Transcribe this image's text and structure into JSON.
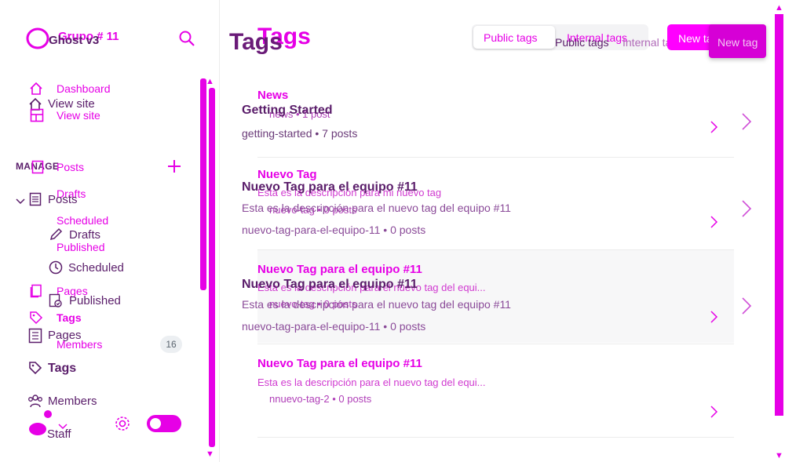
{
  "site": {
    "name_a": "Grupo # 11",
    "name_b": "Ghost v3"
  },
  "sidebar": {
    "dashboard": "Dashboard",
    "view_site_a": "View site",
    "view_site_b": "View site",
    "manage": "MANAGE",
    "posts_a": "Posts",
    "posts_b": "Posts",
    "drafts_a": "Drafts",
    "drafts_b": "Drafts",
    "scheduled_a": "Scheduled",
    "scheduled_b": "Scheduled",
    "published_a": "Published",
    "published_b": "Published",
    "pages_a": "Pages",
    "pages_b": "Pages",
    "tags_a": "Tags",
    "tags_b": "Tags",
    "members_a": "Members",
    "members_b": "Members",
    "members_count": "16",
    "staff": "Staff"
  },
  "header": {
    "title_a": "Tags",
    "title_b": "Tags",
    "tab_public_a": "Public tags",
    "tab_public_b": "Public tags",
    "tab_internal_a": "Internal tags",
    "tab_internal_b": "Internal tags",
    "new_tag_a": "New tag",
    "new_tag_b": "New tag"
  },
  "tags_a": [
    {
      "title": "News",
      "description": "",
      "meta": "news • 1 post"
    },
    {
      "title": "Nuevo Tag",
      "description": "Esta es la descripción para mi nuevo tag",
      "meta": "nuevo-tag • 0 posts"
    },
    {
      "title": "Nuevo Tag para el equipo #11",
      "description": "Esta es la descripción para el nuevo tag del equi...",
      "meta": "nuevo-tag • 0 posts"
    },
    {
      "title": "Nuevo Tag para el equipo #11",
      "description": "Esta es la descripción para el nuevo tag del equi...",
      "meta": "nnuevo-tag-2 • 0 posts"
    }
  ],
  "tags_b": [
    {
      "title": "Getting Started",
      "description": "",
      "meta": "getting-started • 7 posts"
    },
    {
      "title": "Nuevo Tag para el equipo #11",
      "description": "Esta es la descripción para el nuevo tag del equipo #11",
      "meta": "nuevo-tag-para-el-equipo-11 • 0 posts"
    },
    {
      "title": "Nuevo Tag para el equipo #11",
      "description": "Esta es la descripción para el nuevo tag del equipo #11",
      "meta": "nuevo-tag-para-el-equipo-11 • 0 posts"
    }
  ],
  "colors": {
    "accent": "#e600e6",
    "dark_text": "#5a1d6a",
    "button": "#ff00ff"
  }
}
